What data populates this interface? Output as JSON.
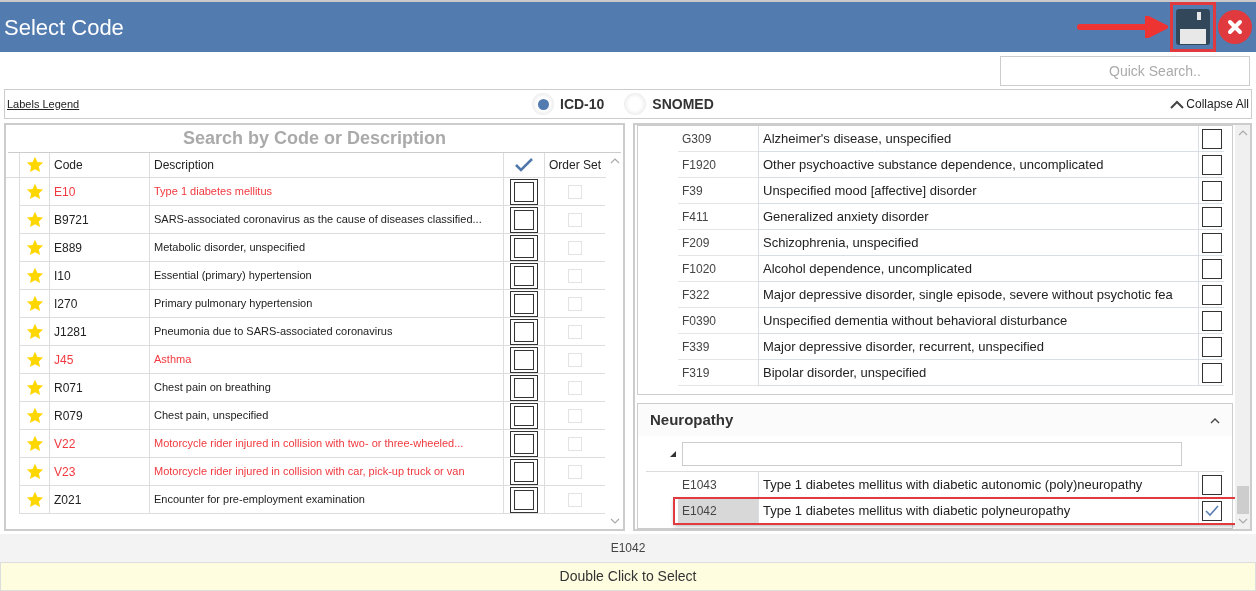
{
  "window": {
    "title": "Select Code"
  },
  "quick_search": {
    "placeholder": "Quick Search.."
  },
  "labels_legend": "Labels Legend",
  "code_systems": [
    {
      "label": "ICD-10",
      "selected": true
    },
    {
      "label": "SNOMED",
      "selected": false
    }
  ],
  "collapse_all": "Collapse All",
  "favorites": {
    "title": "Search by Code or Description",
    "columns": [
      "Code",
      "Description",
      "Order Set"
    ],
    "rows": [
      {
        "code": "E10",
        "description": "Type 1 diabetes mellitus",
        "highlight": true,
        "checked": false
      },
      {
        "code": "B9721",
        "description": "SARS-associated coronavirus as the cause of diseases classified...",
        "highlight": false,
        "checked": false
      },
      {
        "code": "E889",
        "description": "Metabolic disorder, unspecified",
        "highlight": false,
        "checked": false
      },
      {
        "code": "I10",
        "description": "Essential (primary) hypertension",
        "highlight": false,
        "checked": false
      },
      {
        "code": "I270",
        "description": "Primary pulmonary hypertension",
        "highlight": false,
        "checked": false
      },
      {
        "code": "J1281",
        "description": "Pneumonia due to SARS-associated coronavirus",
        "highlight": false,
        "checked": false
      },
      {
        "code": "J45",
        "description": "Asthma",
        "highlight": true,
        "checked": false
      },
      {
        "code": "R071",
        "description": "Chest pain on breathing",
        "highlight": false,
        "checked": false
      },
      {
        "code": "R079",
        "description": "Chest pain, unspecified",
        "highlight": false,
        "checked": false
      },
      {
        "code": "V22",
        "description": "Motorcycle rider injured in collision with two- or three-wheeled...",
        "highlight": true,
        "checked": false
      },
      {
        "code": "V23",
        "description": "Motorcycle rider injured in collision with car, pick-up truck or van",
        "highlight": true,
        "checked": false
      },
      {
        "code": "Z021",
        "description": "Encounter for pre-employment examination",
        "highlight": false,
        "checked": false
      }
    ]
  },
  "group_rows": [
    {
      "code": "G309",
      "description": "Alzheimer's disease, unspecified",
      "checked": false
    },
    {
      "code": "F1920",
      "description": "Other psychoactive substance dependence, uncomplicated",
      "checked": false
    },
    {
      "code": "F39",
      "description": "Unspecified mood [affective] disorder",
      "checked": false
    },
    {
      "code": "F411",
      "description": "Generalized anxiety disorder",
      "checked": false
    },
    {
      "code": "F209",
      "description": "Schizophrenia, unspecified",
      "checked": false
    },
    {
      "code": "F1020",
      "description": "Alcohol dependence, uncomplicated",
      "checked": false
    },
    {
      "code": "F322",
      "description": "Major depressive disorder, single episode, severe without psychotic fea",
      "checked": false
    },
    {
      "code": "F0390",
      "description": "Unspecified dementia without behavioral disturbance",
      "checked": false
    },
    {
      "code": "F339",
      "description": "Major depressive disorder, recurrent, unspecified",
      "checked": false
    },
    {
      "code": "F319",
      "description": "Bipolar disorder, unspecified",
      "checked": false
    }
  ],
  "neuropathy": {
    "title": "Neuropathy",
    "expanded": true,
    "rows": [
      {
        "code": "E1043",
        "description": "Type 1 diabetes mellitus with diabetic autonomic (poly)neuropathy",
        "checked": false,
        "selected": false
      },
      {
        "code": "E1042",
        "description": "Type 1 diabetes mellitus with diabetic polyneuropathy",
        "checked": true,
        "selected": true
      }
    ]
  },
  "status": {
    "selected_code": "E1042",
    "hint": "Double Click to Select"
  }
}
